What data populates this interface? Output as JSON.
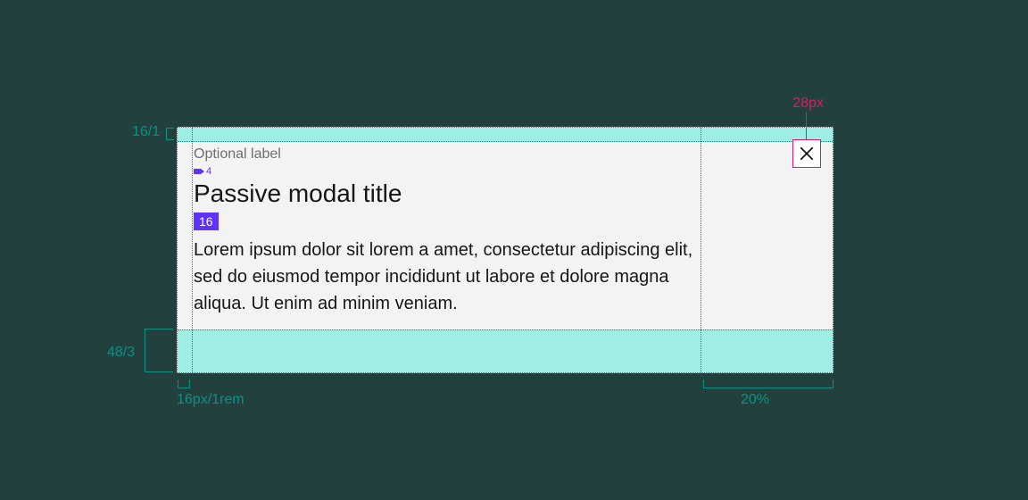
{
  "spec": {
    "top_padding_label": "16/1",
    "bottom_padding_label": "48/3",
    "left_padding_label": "16px/1rem",
    "right_region_label": "20%",
    "close_size_label": "28px",
    "title_gap_value": "4",
    "body_gap_value": "16"
  },
  "modal": {
    "optional_label": "Optional label",
    "title": "Passive modal title",
    "body": "Lorem ipsum dolor sit lorem a amet, consectetur adipiscing elit, sed do eiusmod tempor incididunt ut labore et dolore magna aliqua. Ut enim ad minim veniam."
  },
  "colors": {
    "teal_band": "#9feee3",
    "teal_line": "#138778",
    "teal_text": "#0a9184",
    "purple": "#6032ff",
    "pink": "#e31869",
    "modal_bg": "#f3f3f3",
    "page_bg": "#22413e"
  }
}
